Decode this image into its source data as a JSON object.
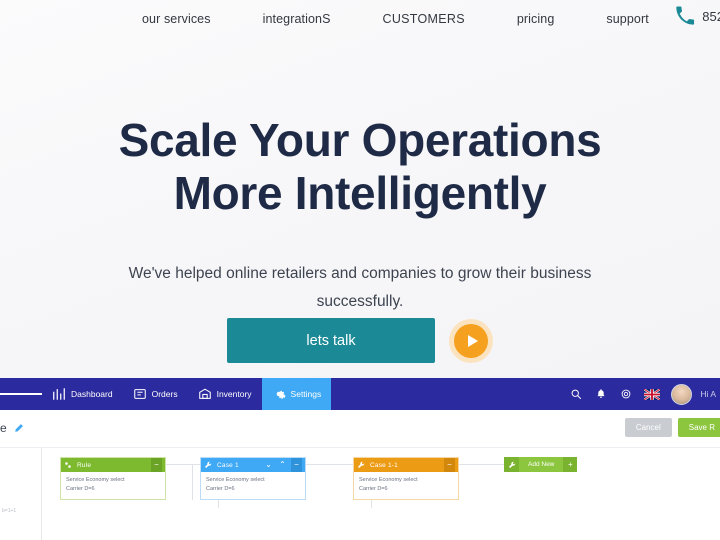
{
  "site": {
    "nav": [
      {
        "label": "our services",
        "name": "nav-our-services"
      },
      {
        "label": "integrationS",
        "name": "nav-integrations"
      },
      {
        "label": "CUSTOMERS",
        "name": "nav-customers"
      },
      {
        "label": "pricing",
        "name": "nav-pricing"
      },
      {
        "label": "support",
        "name": "nav-support"
      }
    ],
    "phone": {
      "icon": "phone-icon",
      "number": "852",
      "color": "#1c8a96"
    },
    "hero": {
      "title_line1": "Scale Your Operations",
      "title_line2": "More Intelligently",
      "title_color": "#1f2b46",
      "subtitle": "We've helped online retailers and companies to grow their business successfully.",
      "cta_label": "lets talk",
      "cta_color": "#1c8a96",
      "play_button_label": "play-video",
      "play_color": "#f5a01e"
    }
  },
  "app": {
    "toolbar": {
      "menu_icon": "hamburger-icon",
      "items": [
        {
          "label": "Dashboard",
          "icon": "bar-chart-icon",
          "active": false
        },
        {
          "label": "Orders",
          "icon": "orders-icon",
          "active": false
        },
        {
          "label": "Inventory",
          "icon": "warehouse-icon",
          "active": false
        },
        {
          "label": "Settings",
          "icon": "gear-icon",
          "active": true
        }
      ],
      "active_color": "#3fa9f5",
      "bar_color": "#2b2a9e",
      "right_icons": [
        {
          "name": "search-icon"
        },
        {
          "name": "bell-icon"
        },
        {
          "name": "gear-icon"
        },
        {
          "name": "uk-flag-icon"
        }
      ],
      "user": {
        "avatar": "avatar",
        "greeting": "Hi A"
      }
    },
    "subbar": {
      "rule_name": "me",
      "edit_icon": "pencil-icon",
      "cancel_label": "Cancel",
      "save_label": "Save R",
      "cancel_color": "#c9ccd1",
      "save_color": "#8cc63e"
    },
    "flow": {
      "tiny_label": "b=1+1",
      "nodes": [
        {
          "title": "Rule",
          "color": "green",
          "icon": "rule-icon",
          "body_line1": "Service Economy select",
          "body_line2": "Carrier D=6",
          "controls": [
            "minus"
          ]
        },
        {
          "title": "Case 1",
          "color": "blue",
          "icon": "wrench-icon",
          "body_line1": "Service Economy select",
          "body_line2": "Carrier D=6",
          "controls": [
            "chevron-down",
            "chevron-up",
            "minus"
          ]
        },
        {
          "title": "Case 1-1",
          "color": "orange",
          "icon": "wrench-icon",
          "body_line1": "Service Economy select",
          "body_line2": "Carrier D=6",
          "controls": [
            "minus"
          ]
        }
      ],
      "add_new": {
        "label": "Add New",
        "icon": "wrench-icon",
        "plus": "+",
        "color": "#8cc63e"
      }
    }
  }
}
